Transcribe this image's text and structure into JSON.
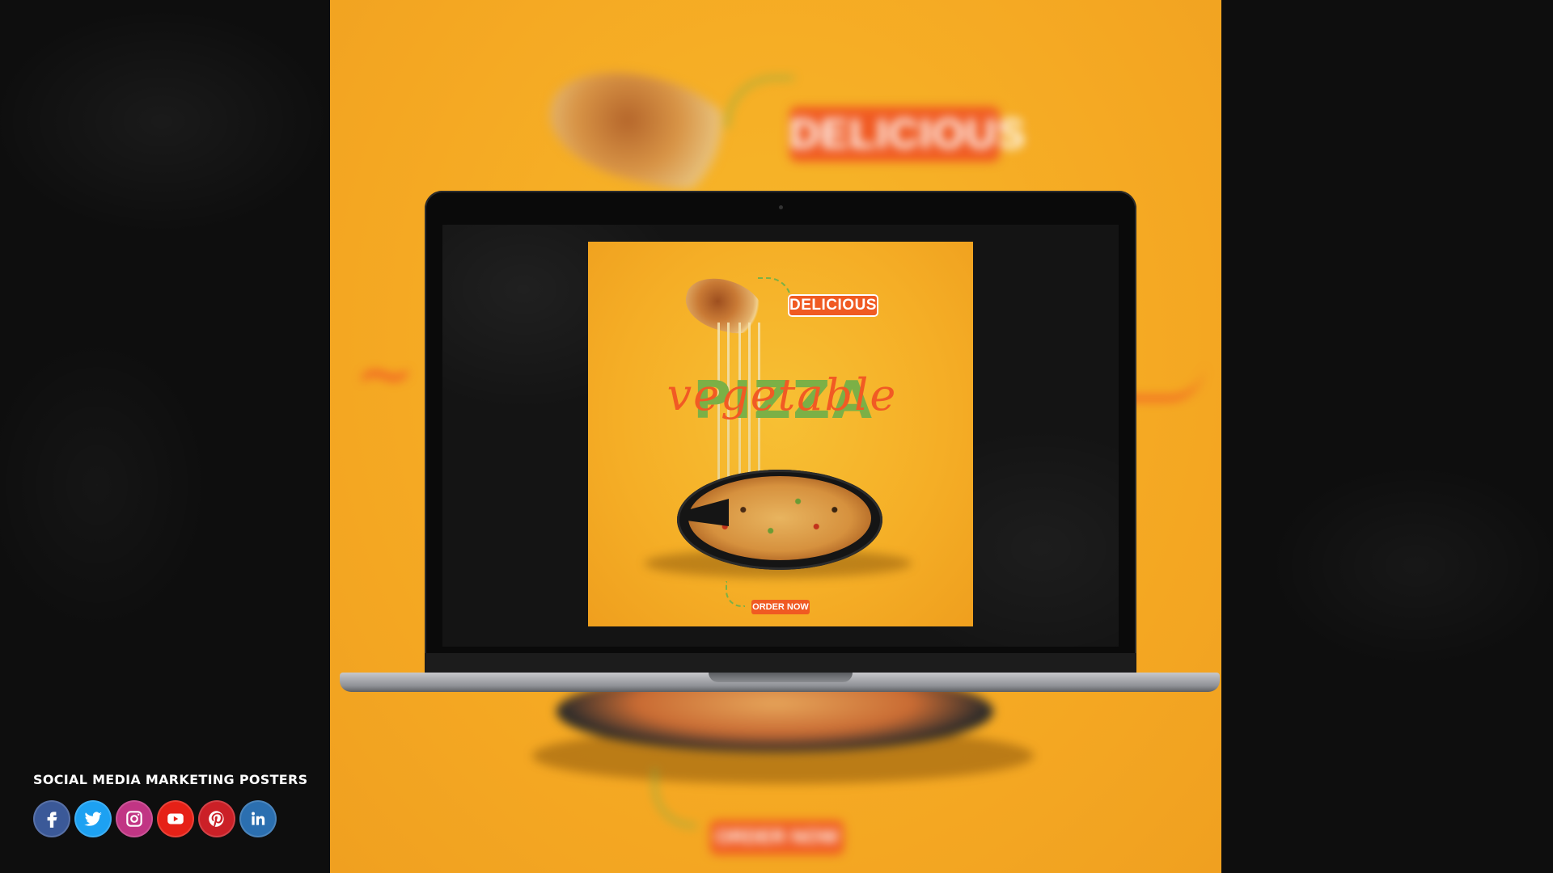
{
  "poster_background": {
    "badge": "DELICIOUS",
    "order": "ORDER NOW"
  },
  "screen_poster": {
    "badge": "DELICIOUS",
    "headline": "PIZZA",
    "script": "vegetable",
    "order": "ORDER NOW"
  },
  "branding": {
    "title": "SOCIAL MEDIA MARKETING POSTERS",
    "icons": [
      {
        "name": "facebook-icon",
        "color": "#3b5998"
      },
      {
        "name": "twitter-icon",
        "color": "#1da1f2"
      },
      {
        "name": "instagram-icon",
        "color": "#c13584"
      },
      {
        "name": "youtube-icon",
        "color": "#e62117"
      },
      {
        "name": "pinterest-icon",
        "color": "#cb2027"
      },
      {
        "name": "linkedin-icon",
        "color": "#2b6fb0"
      }
    ]
  },
  "colors": {
    "poster_yellow": "#f5ae26",
    "accent_orange": "#f05a22",
    "accent_green": "#7bb046"
  }
}
